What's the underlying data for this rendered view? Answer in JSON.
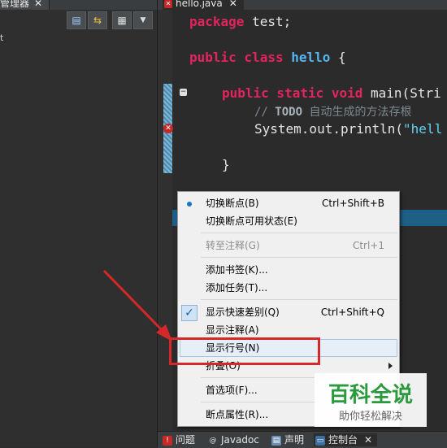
{
  "left_panel": {
    "tab_label": "管理器",
    "tab_close": "✕",
    "tree_item": "t"
  },
  "editor": {
    "tab_label": "hello.java",
    "tab_close": "✕",
    "code": {
      "l1_kw": "package",
      "l1_rest": " test;",
      "l2_kw": "public class",
      "l2_cls": "hello",
      "l2_rest": " {",
      "l3_kw": "public static void",
      "l3_rest": " main(Stri",
      "l4_pre": "// ",
      "l4_todo": "TODO",
      "l4_rest": " 自动生成的方法存根",
      "l5_pre": "System.out.println(",
      "l5_str": "\"hell",
      "l6": "}"
    }
  },
  "context_menu": {
    "items": [
      {
        "label": "切换断点(B)",
        "shortcut": "Ctrl+Shift+B"
      },
      {
        "label": "切换断点可用状态(E)",
        "shortcut": ""
      },
      {
        "label": "转至注释(G)",
        "shortcut": "Ctrl+1"
      },
      {
        "label": "添加书签(K)...",
        "shortcut": ""
      },
      {
        "label": "添加任务(T)...",
        "shortcut": ""
      },
      {
        "label": "显示快速差别(Q)",
        "shortcut": "Ctrl+Shift+Q"
      },
      {
        "label": "显示注释(A)",
        "shortcut": ""
      },
      {
        "label": "显示行号(N)",
        "shortcut": ""
      },
      {
        "label": "折叠(O)",
        "shortcut": ""
      },
      {
        "label": "首选项(F)...",
        "shortcut": ""
      },
      {
        "label": "断点属性(R)...",
        "shortcut": ""
      }
    ]
  },
  "watermark": {
    "title": "百科全说",
    "subtitle": "助你轻松解决"
  },
  "bottom_tabs": {
    "problems": "问题",
    "javadoc": "Javadoc",
    "declaration": "声明",
    "console": "控制台",
    "console_close": "✕"
  },
  "colors": {
    "keyword": "#e3245e",
    "class_name": "#56b6f0",
    "annotation_red": "#d62828",
    "watermark_green": "#2a9a3c"
  },
  "icons": [
    "close-icon",
    "collapse-all-icon",
    "link-with-editor-icon",
    "view-menu-icon",
    "dropdown-arrow-icon",
    "error-icon",
    "fold-icon",
    "radio-dot-icon",
    "checkmark-icon",
    "submenu-arrow-icon",
    "problems-icon",
    "javadoc-icon",
    "declaration-icon",
    "console-icon",
    "red-arrow-annotation"
  ]
}
